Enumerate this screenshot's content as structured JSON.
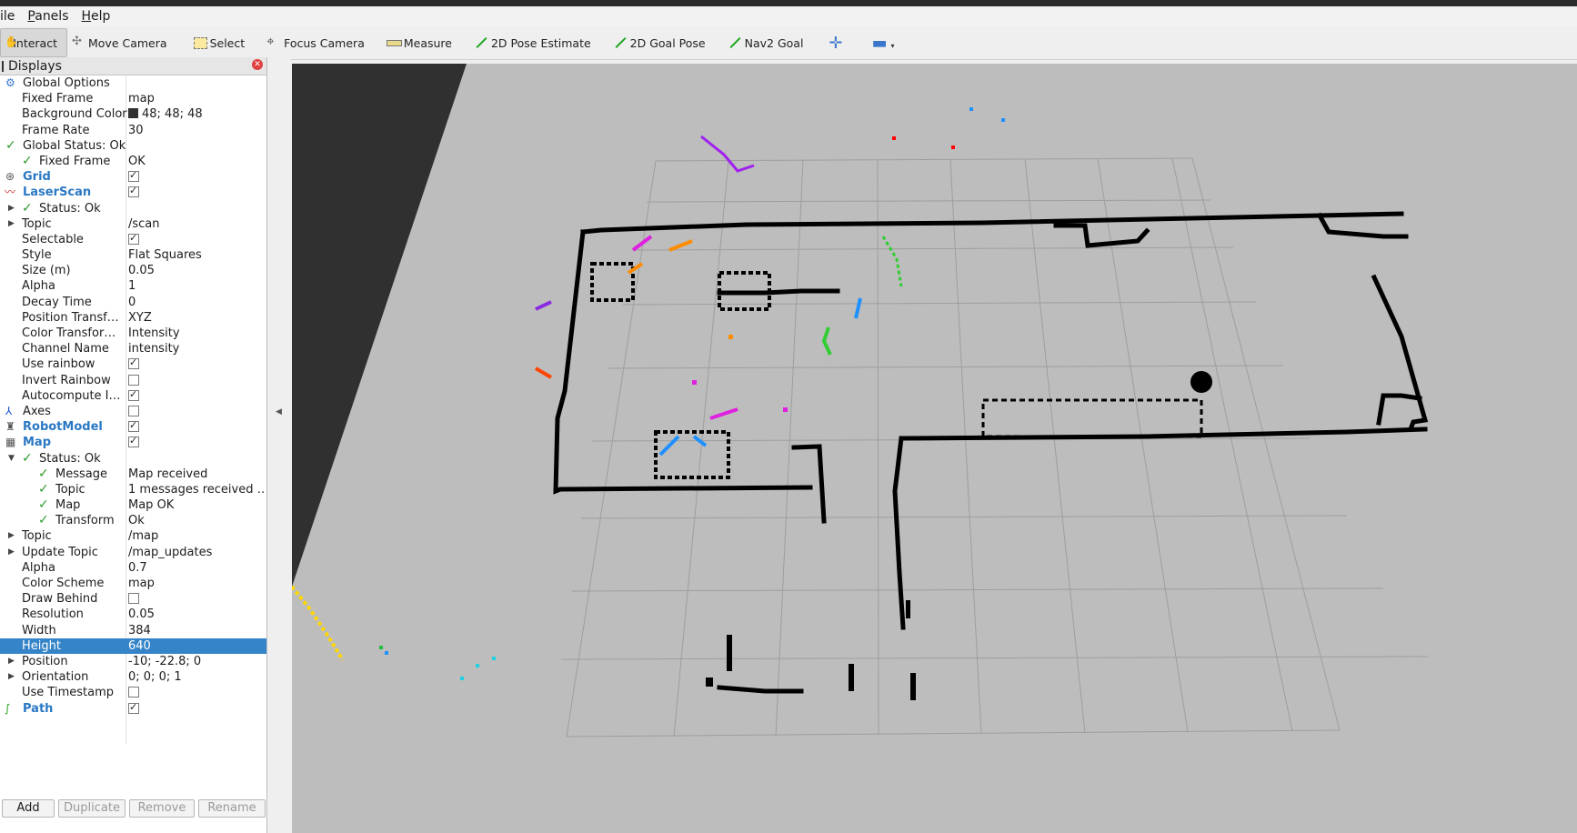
{
  "menu": {
    "items": [
      "ile",
      "Panels",
      "Help"
    ]
  },
  "toolbar": {
    "interact": "Interact",
    "move_camera": "Move Camera",
    "select": "Select",
    "focus_camera": "Focus Camera",
    "measure": "Measure",
    "pose_estimate": "2D Pose Estimate",
    "goal_pose": "2D Goal Pose",
    "nav2_goal": "Nav2 Goal",
    "plus": "✛",
    "minus": "▬"
  },
  "displays": {
    "title": "Displays",
    "rows": [
      {
        "name": "Global Options",
        "value": ""
      },
      {
        "name": "Fixed Frame",
        "value": "map"
      },
      {
        "name": "Background Color",
        "value": "48; 48; 48"
      },
      {
        "name": "Frame Rate",
        "value": "30"
      },
      {
        "name": "Global Status: Ok",
        "value": ""
      },
      {
        "name": "Fixed Frame",
        "value": "OK"
      },
      {
        "name": "Grid",
        "value": ""
      },
      {
        "name": "LaserScan",
        "value": ""
      },
      {
        "name": "Status: Ok",
        "value": ""
      },
      {
        "name": "Topic",
        "value": "/scan"
      },
      {
        "name": "Selectable",
        "value": ""
      },
      {
        "name": "Style",
        "value": "Flat Squares"
      },
      {
        "name": "Size (m)",
        "value": "0.05"
      },
      {
        "name": "Alpha",
        "value": "1"
      },
      {
        "name": "Decay Time",
        "value": "0"
      },
      {
        "name": "Position Transf…",
        "value": "XYZ"
      },
      {
        "name": "Color Transfor…",
        "value": "Intensity"
      },
      {
        "name": "Channel Name",
        "value": "intensity"
      },
      {
        "name": "Use rainbow",
        "value": ""
      },
      {
        "name": "Invert Rainbow",
        "value": ""
      },
      {
        "name": "Autocompute I…",
        "value": ""
      },
      {
        "name": "Axes",
        "value": ""
      },
      {
        "name": "RobotModel",
        "value": ""
      },
      {
        "name": "Map",
        "value": ""
      },
      {
        "name": "Status: Ok",
        "value": ""
      },
      {
        "name": "Message",
        "value": "Map received"
      },
      {
        "name": "Topic",
        "value": "1 messages received …"
      },
      {
        "name": "Map",
        "value": "Map OK"
      },
      {
        "name": "Transform",
        "value": "Ok"
      },
      {
        "name": "Topic",
        "value": "/map"
      },
      {
        "name": "Update Topic",
        "value": "/map_updates"
      },
      {
        "name": "Alpha",
        "value": "0.7"
      },
      {
        "name": "Color Scheme",
        "value": "map"
      },
      {
        "name": "Draw Behind",
        "value": ""
      },
      {
        "name": "Resolution",
        "value": "0.05"
      },
      {
        "name": "Width",
        "value": "384"
      },
      {
        "name": "Height",
        "value": "640"
      },
      {
        "name": "Position",
        "value": "-10; -22.8; 0"
      },
      {
        "name": "Orientation",
        "value": "0; 0; 0; 1"
      },
      {
        "name": "Use Timestamp",
        "value": ""
      },
      {
        "name": "Path",
        "value": ""
      }
    ],
    "buttons": {
      "add": "Add",
      "duplicate": "Duplicate",
      "remove": "Remove",
      "rename": "Rename"
    }
  },
  "colors": {
    "selection": "#3584c8",
    "enabled_display": "#2a78c4",
    "status_ok": "#2c9a2c",
    "viewport_bg": "#a8a8a8",
    "map_wall": "#000000"
  }
}
